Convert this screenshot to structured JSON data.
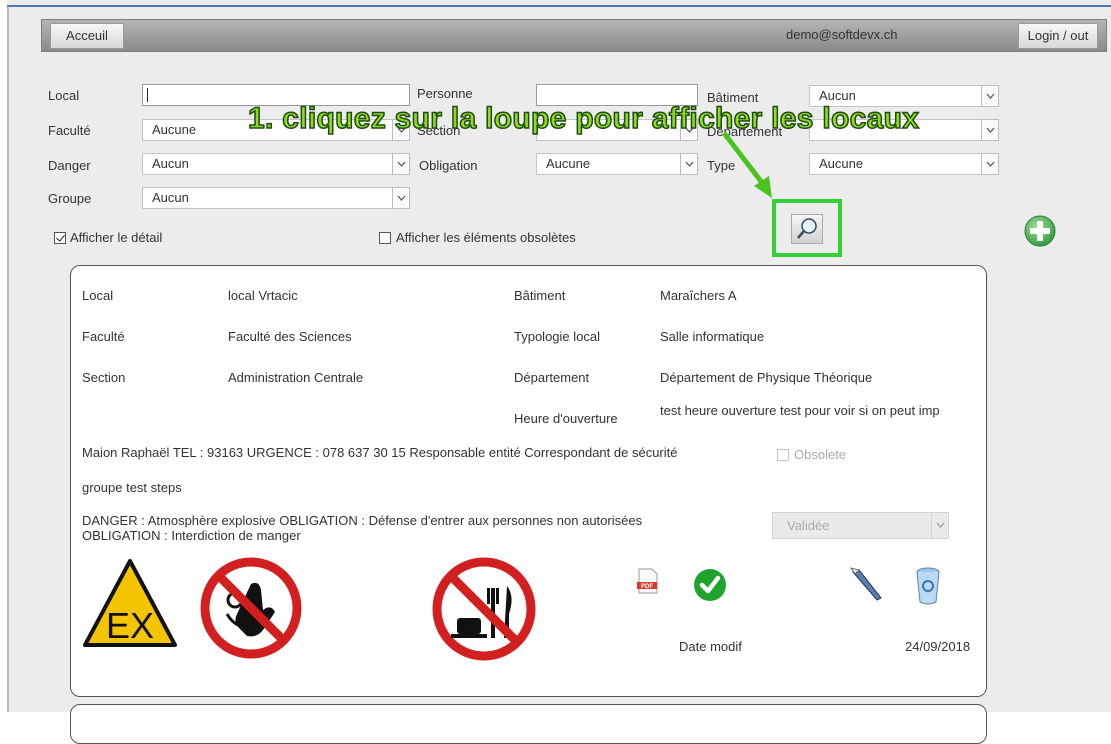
{
  "topbar": {
    "home_label": "Acceuil",
    "user_email": "demo@softdevx.ch",
    "login_label": "Login / out"
  },
  "filters": {
    "local_label": "Local",
    "local_value": "",
    "personne_label": "Personne",
    "personne_value": "",
    "batiment_label": "Bâtiment",
    "batiment_value": "Aucun",
    "faculte_label": "Faculté",
    "faculte_value": "Aucune",
    "section_label": "Section",
    "section_value": "",
    "departement_label": "Département",
    "departement_value": "",
    "danger_label": "Danger",
    "danger_value": "Aucun",
    "obligation_label": "Obligation",
    "obligation_value": "Aucune",
    "type_label": "Type",
    "type_value": "Aucune",
    "groupe_label": "Groupe",
    "groupe_value": "Aucun",
    "detail_label": "Afficher le détail",
    "detail_checked": true,
    "obsolete_label": "Afficher les éléments obsolètes",
    "obsolete_checked": false
  },
  "annotation": {
    "text": "1. cliquez sur la loupe pour afficher les locaux"
  },
  "icons": {
    "search": "magnifier-icon",
    "add": "plus-icon",
    "pdf": "pdf-icon",
    "validate": "checkmark-icon",
    "edit": "pen-icon",
    "delete": "trash-icon",
    "dropdown": "chevron-down-icon"
  },
  "colors": {
    "highlight_border": "#35d036",
    "annotation_text": "#8ddc1f",
    "topbar": "#9a9a9a",
    "validate_green": "#1fa32c",
    "add_green": "#36b44a"
  },
  "card": {
    "local_label": "Local",
    "local_value": "local Vrtacic",
    "batiment_label": "Bâtiment",
    "batiment_value": "Maraîchers A",
    "faculte_label": "Faculté",
    "faculte_value": "Faculté des Sciences",
    "typologie_label": "Typologie local",
    "typologie_value": "Salle informatique",
    "section_label": "Section",
    "section_value": "Administration Centrale",
    "departement_label": "Département",
    "departement_value": "Département de Physique Théorique",
    "heure_label": "Heure d'ouverture",
    "heure_value": "test heure ouverture test pour voir si on peut imp",
    "responsable_text": "Maion Raphaël TEL : 93163 URGENCE : 078 637 30 15 Responsable entité Correspondant de sécurité",
    "obsolete_label": "Obsolete",
    "groupe_text": "groupe test steps",
    "danger_text": "DANGER : Atmosphère explosive OBLIGATION : Défense d'entrer aux personnes non autorisées OBLIGATION : Interdiction de manger",
    "status_value": "Validée",
    "date_label": "Date modif",
    "date_value": "24/09/2018",
    "sign_ex_text": "EX",
    "pdf_text": "PDF"
  }
}
